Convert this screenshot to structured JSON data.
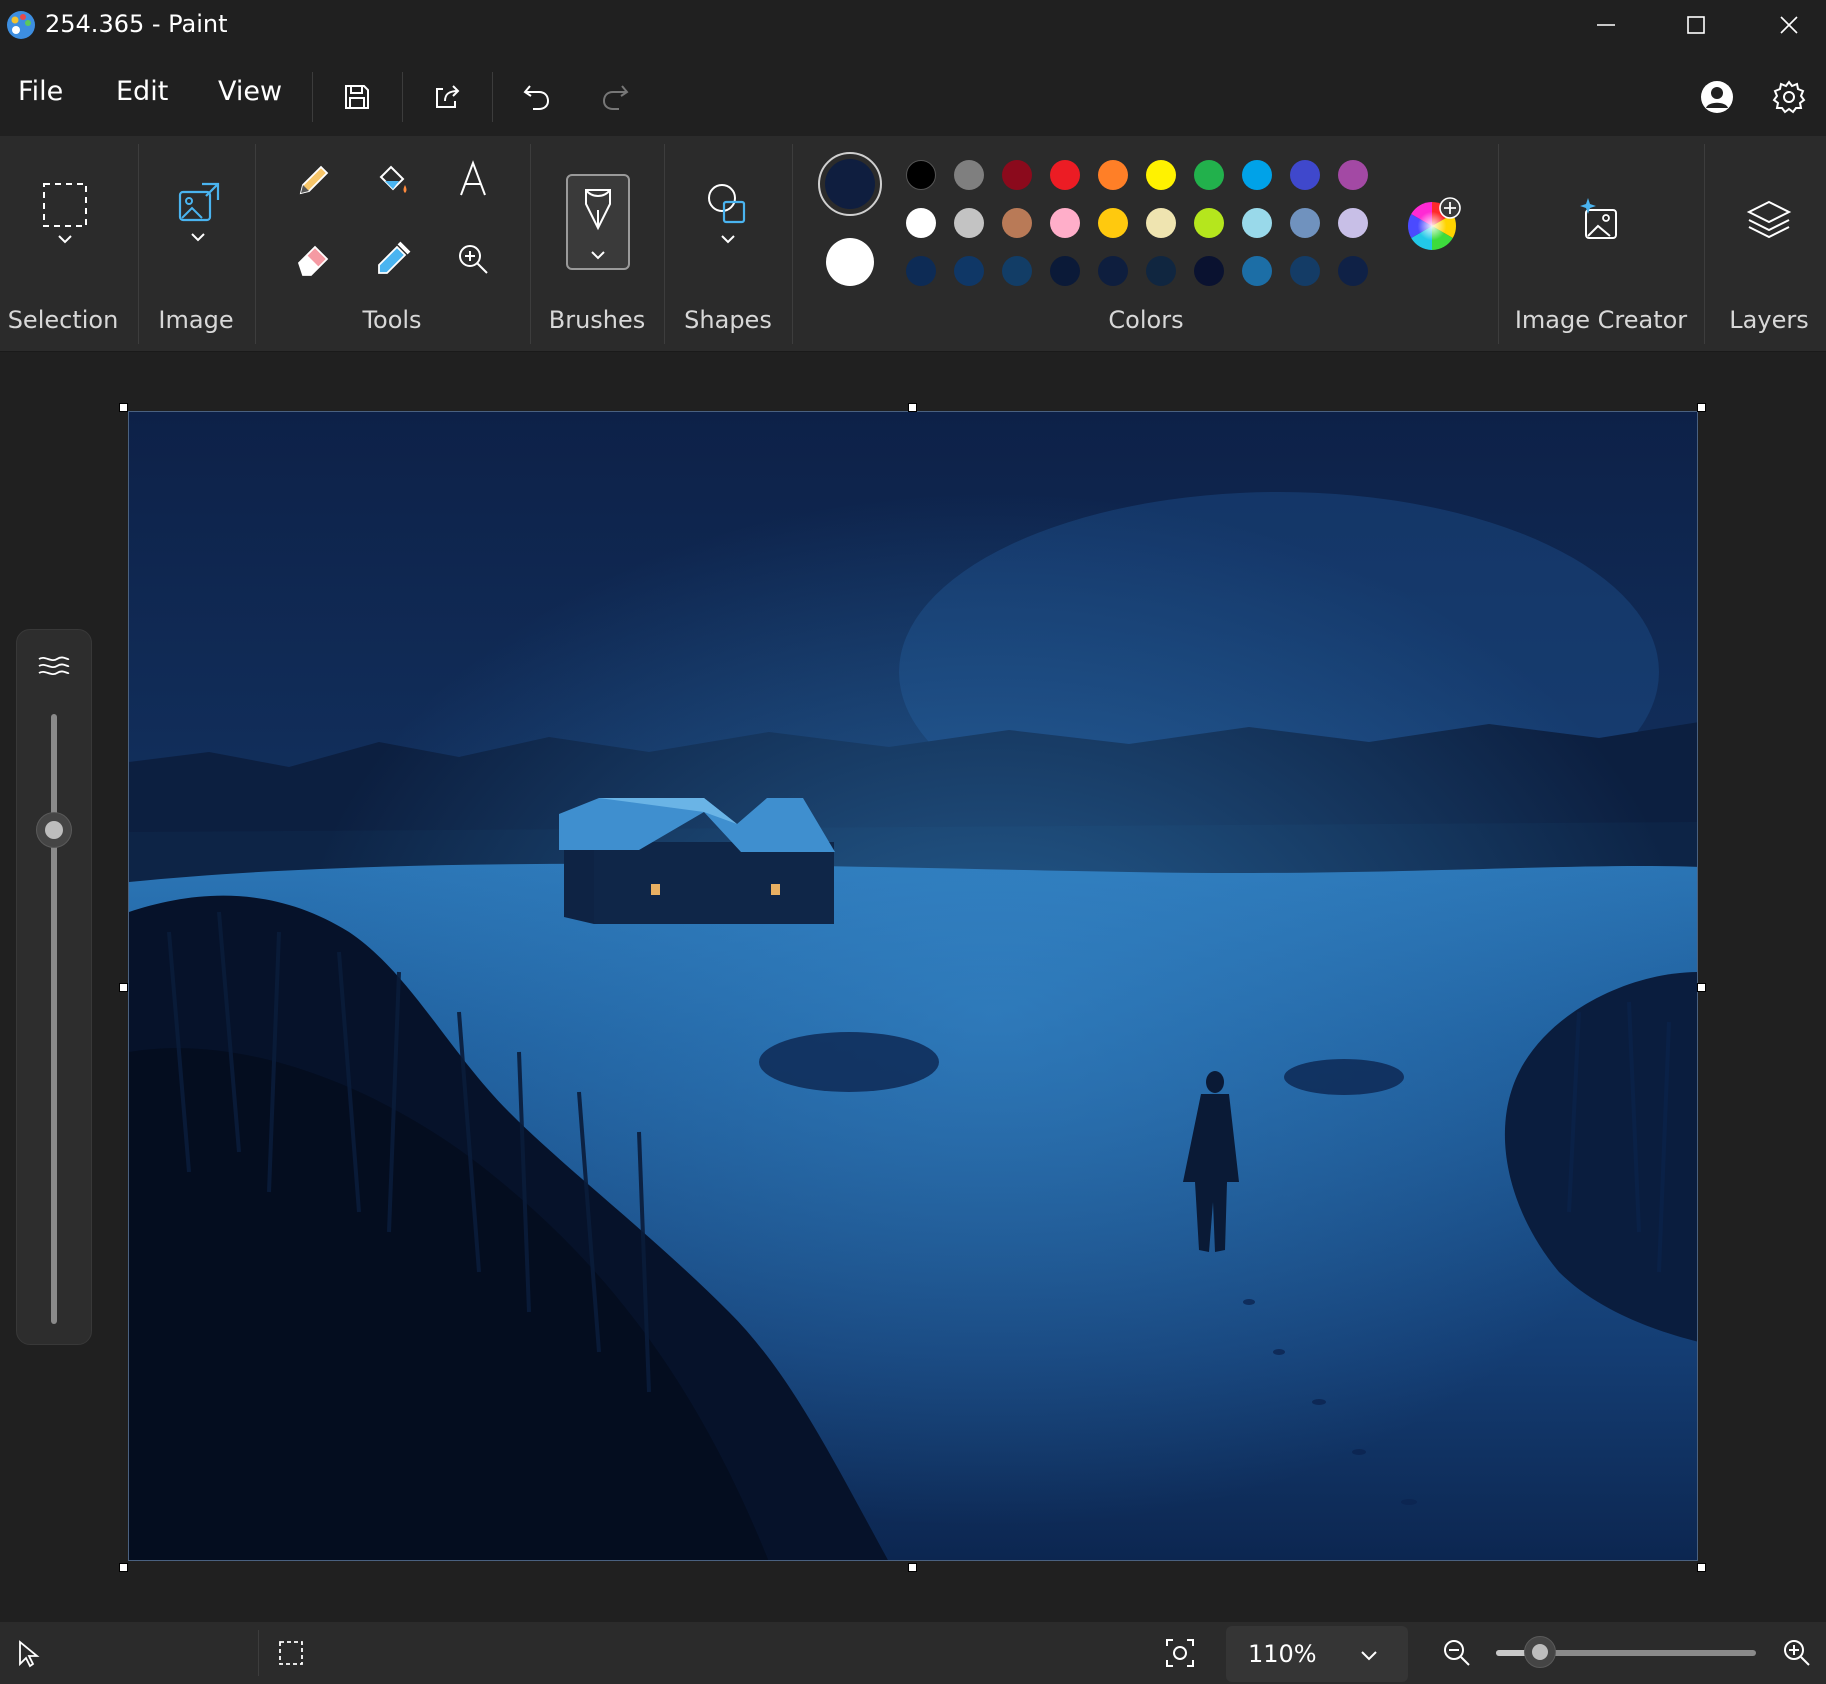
{
  "window": {
    "title": "254.365 - Paint",
    "icons": {
      "app": "paint-palette-icon",
      "minimize": "minimize-icon",
      "maximize": "maximize-icon",
      "close": "close-icon"
    }
  },
  "menu": {
    "file": "File",
    "edit": "Edit",
    "view": "View",
    "icons": [
      "save-icon",
      "share-icon",
      "undo-icon",
      "redo-icon",
      "account-icon",
      "settings-icon"
    ]
  },
  "ribbon": {
    "groups": {
      "selection": "Selection",
      "image": "Image",
      "tools": "Tools",
      "brushes": "Brushes",
      "shapes": "Shapes",
      "colors": "Colors",
      "image_creator": "Image Creator",
      "layers": "Layers"
    },
    "tools": [
      "pencil-icon",
      "fill-bucket-icon",
      "text-icon",
      "eraser-icon",
      "color-picker-icon",
      "magnifier-icon"
    ],
    "colors": {
      "primary": "#0f1e3f",
      "secondary": "#ffffff",
      "palette_row1": [
        "#000000",
        "#7f7f7f",
        "#8b0a1c",
        "#ec1c24",
        "#ff7f27",
        "#fff200",
        "#22b14c",
        "#00a2e8",
        "#3f48cc",
        "#a349a4"
      ],
      "palette_row2": [
        "#ffffff",
        "#c3c3c3",
        "#b97a57",
        "#ffaec9",
        "#ffc90e",
        "#efe4b0",
        "#b5e61d",
        "#99d9ea",
        "#7092be",
        "#c8bfe7"
      ],
      "palette_row3": [
        "#0d2b55",
        "#0f3766",
        "#123d66",
        "#0b1a38",
        "#0e1e3e",
        "#102640",
        "#0a1230",
        "#1c6ea6",
        "#143c66",
        "#0f2146"
      ]
    }
  },
  "status": {
    "zoom": "110%",
    "zoom_slider_fraction": 0.17
  }
}
